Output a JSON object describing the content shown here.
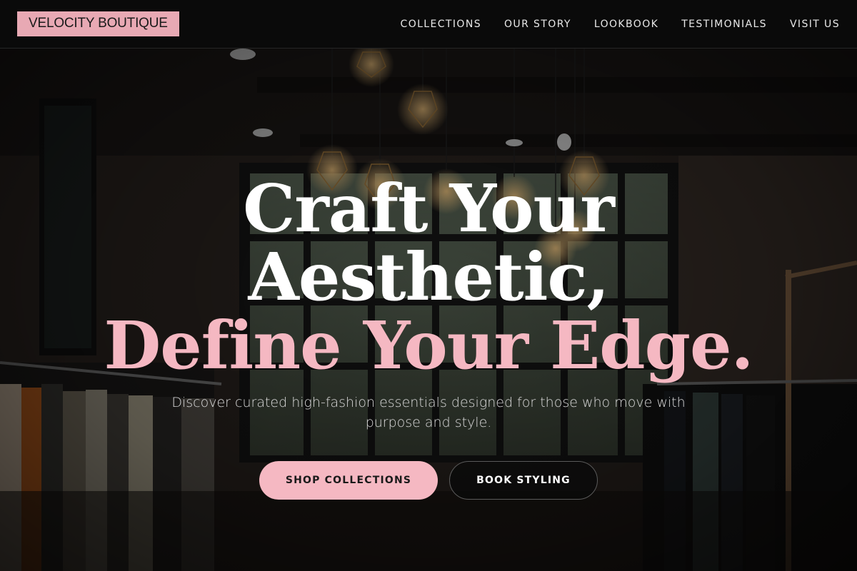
{
  "brand": {
    "name": "VELOCITY BOUTIQUE",
    "accent_color": "#e8a9b4"
  },
  "nav": {
    "items": [
      {
        "label": "COLLECTIONS"
      },
      {
        "label": "OUR STORY"
      },
      {
        "label": "LOOKBOOK"
      },
      {
        "label": "TESTIMONIALS"
      },
      {
        "label": "VISIT US"
      }
    ]
  },
  "hero": {
    "headline_line1": "Craft Your",
    "headline_line2": "Aesthetic,",
    "headline_line3": "Define Your Edge.",
    "subtitle": "Discover curated high-fashion essentials designed for those who move with purpose and style.",
    "primary_button": "SHOP COLLECTIONS",
    "secondary_button": "BOOK STYLING",
    "highlight_color": "#f5b8c2"
  }
}
